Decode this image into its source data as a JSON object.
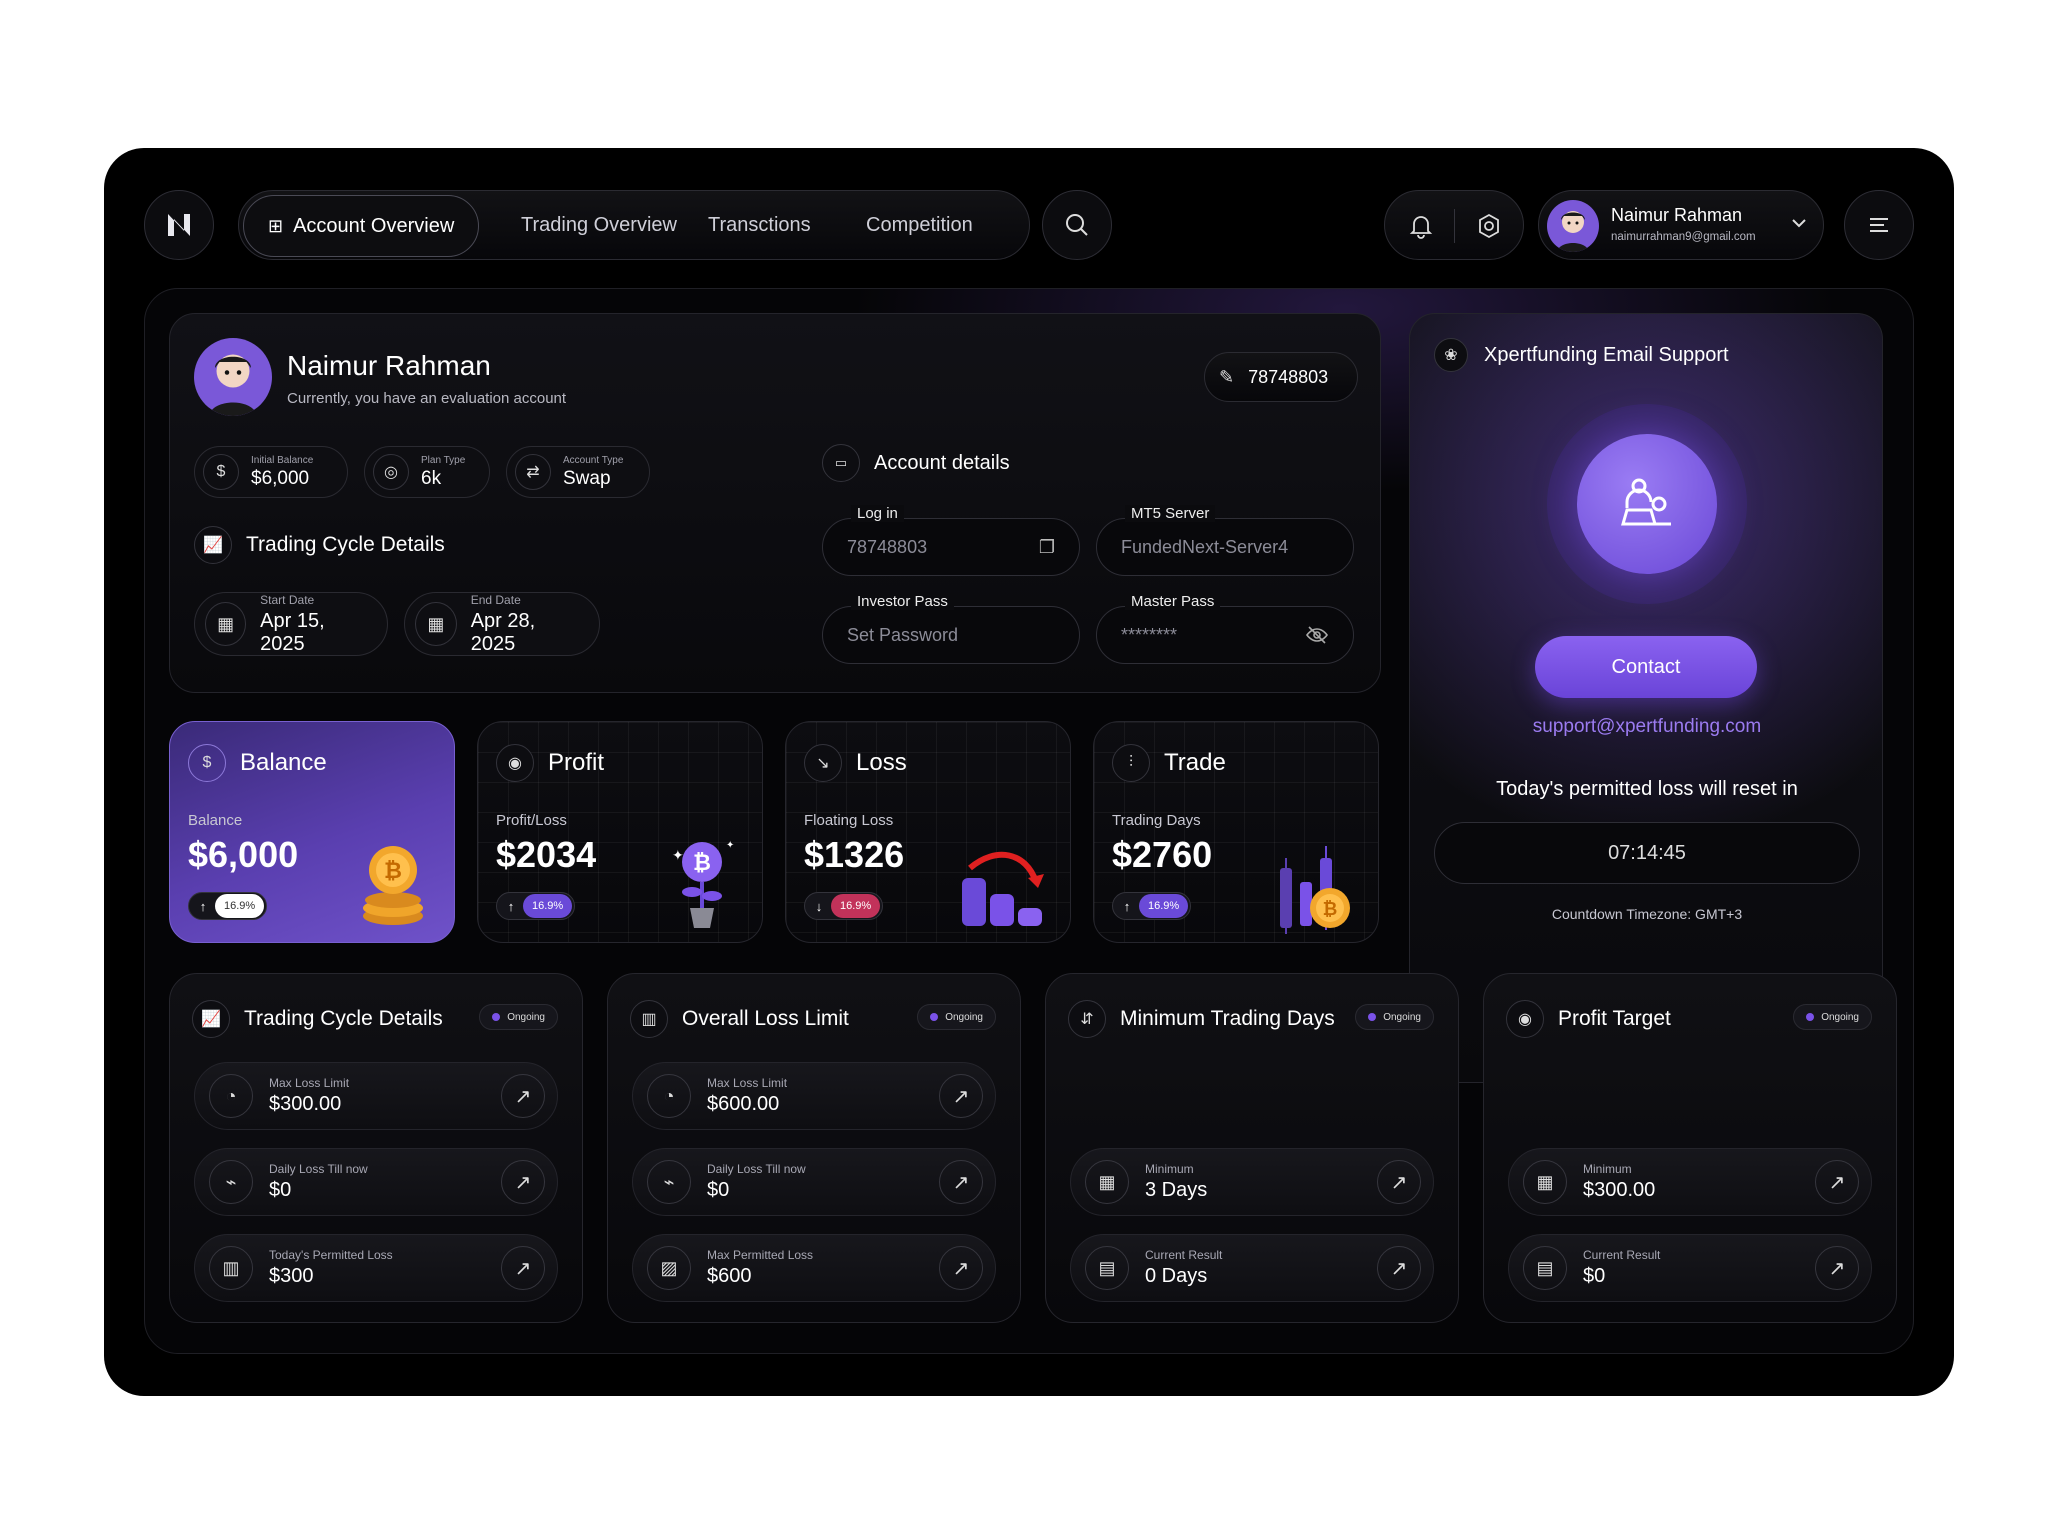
{
  "topbar": {
    "logo": "N",
    "nav": [
      {
        "label": "Account Overview",
        "active": true
      },
      {
        "label": "Trading Overview"
      },
      {
        "label": "Transctions"
      },
      {
        "label": "Competition"
      }
    ],
    "user": {
      "name": "Naimur Rahman",
      "email": "naimurrahman9@gmail.com"
    }
  },
  "profile": {
    "name": "Naimur Rahman",
    "subtitle": "Currently, you have an evaluation account",
    "account_id": "78748803",
    "chips": [
      {
        "label": "Initial Balance",
        "value": "$6,000",
        "icon": "dollar-icon"
      },
      {
        "label": "Plan Type",
        "value": "6k",
        "icon": "target-icon"
      },
      {
        "label": "Account Type",
        "value": "Swap",
        "icon": "swap-icon"
      }
    ],
    "cycle_title": "Trading Cycle Details",
    "start": {
      "label": "Start Date",
      "value": "Apr 15, 2025"
    },
    "end": {
      "label": "End Date",
      "value": "Apr 28, 2025"
    }
  },
  "account_details": {
    "title": "Account details",
    "login": {
      "label": "Log in",
      "value": "78748803"
    },
    "server": {
      "label": "MT5 Server",
      "value": "FundedNext-Server4"
    },
    "investor": {
      "label": "Investor Pass",
      "value": "Set Password"
    },
    "master": {
      "label": "Master Pass",
      "value": "********"
    }
  },
  "stats": [
    {
      "title": "Balance",
      "sub": "Balance",
      "value": "$6,000",
      "pct": "16.9%",
      "direction": "up"
    },
    {
      "title": "Profit",
      "sub": "Profit/Loss",
      "value": "$2034",
      "pct": "16.9%",
      "direction": "up"
    },
    {
      "title": "Loss",
      "sub": "Floating Loss",
      "value": "$1326",
      "pct": "16.9%",
      "direction": "down"
    },
    {
      "title": "Trade",
      "sub": "Trading Days",
      "value": "$2760",
      "pct": "16.9%",
      "direction": "up"
    }
  ],
  "support": {
    "title": "Xpertfunding Email Support",
    "contact_label": "Contact",
    "email": "support@xpertfunding.com",
    "reset_text": "Today's permitted loss will reset in",
    "countdown": "07:14:45",
    "timezone": "Countdown Timezone: GMT+3"
  },
  "bottom": [
    {
      "title": "Trading Cycle Details",
      "status": "Ongoing",
      "rows": [
        {
          "label": "Max Loss Limit",
          "value": "$300.00"
        },
        {
          "label": "Daily Loss Till now",
          "value": "$0"
        },
        {
          "label": "Today's Permitted Loss",
          "value": "$300"
        }
      ]
    },
    {
      "title": "Overall Loss Limit",
      "status": "Ongoing",
      "rows": [
        {
          "label": "Max Loss Limit",
          "value": "$600.00"
        },
        {
          "label": "Daily Loss Till now",
          "value": "$0"
        },
        {
          "label": "Max Permitted Loss",
          "value": "$600"
        }
      ]
    },
    {
      "title": "Minimum Trading Days",
      "status": "Ongoing",
      "rows": [
        {
          "label": "Minimum",
          "value": "3 Days"
        },
        {
          "label": "Current Result",
          "value": "0 Days"
        }
      ]
    },
    {
      "title": "Profit Target",
      "status": "Ongoing",
      "rows": [
        {
          "label": "Minimum",
          "value": "$300.00"
        },
        {
          "label": "Current Result",
          "value": "$0"
        }
      ]
    }
  ],
  "colors": {
    "accent": "#7a52e8",
    "accent_light": "#9b7bf0",
    "loss": "#c2325a"
  }
}
